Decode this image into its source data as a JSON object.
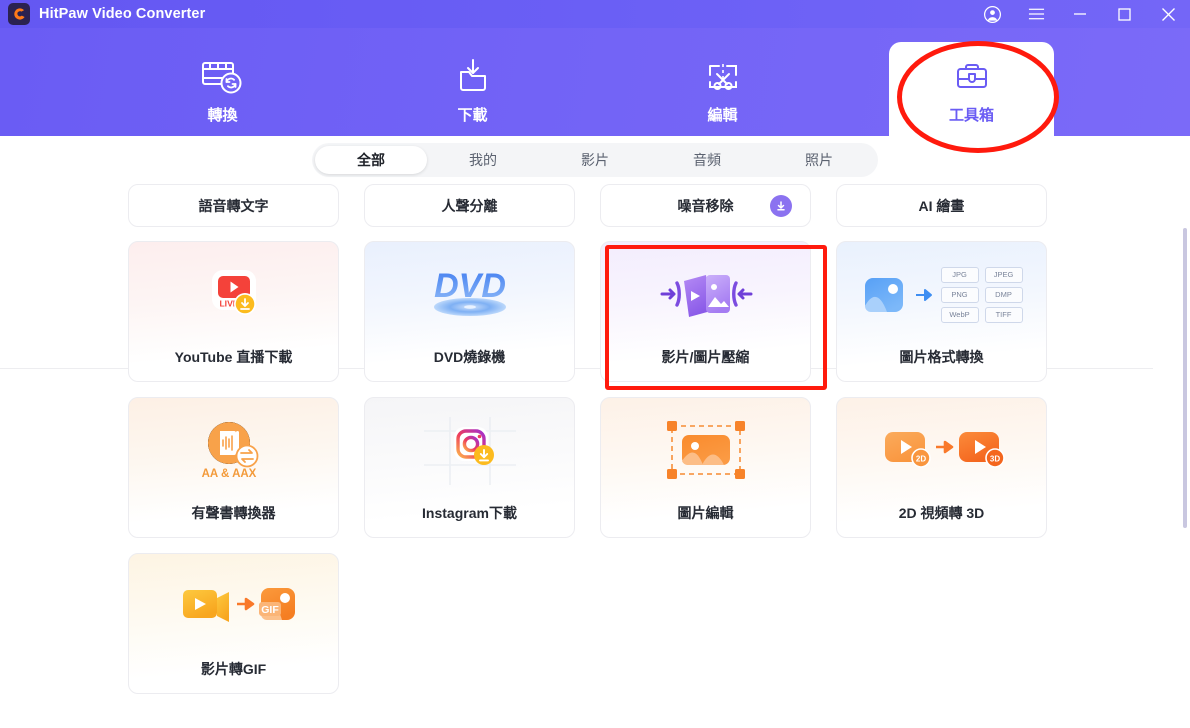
{
  "window": {
    "app_title": "HitPaw Video Converter",
    "logo_icon": "hitpaw-logo-icon",
    "controls": [
      {
        "name": "account-icon",
        "glyph": "account"
      },
      {
        "name": "menu-icon",
        "glyph": "menu"
      },
      {
        "name": "minimize-icon",
        "glyph": "minimize"
      },
      {
        "name": "maximize-icon",
        "glyph": "maximize"
      },
      {
        "name": "close-icon",
        "glyph": "close"
      }
    ],
    "header_color": "#6a5cf4"
  },
  "nav": {
    "tabs": [
      {
        "id": "convert",
        "label": "轉換",
        "icon": "film-convert-icon",
        "active": false
      },
      {
        "id": "download",
        "label": "下載",
        "icon": "folder-download-icon",
        "active": false
      },
      {
        "id": "edit",
        "label": "編輯",
        "icon": "screen-scissors-icon",
        "active": false
      },
      {
        "id": "toolbox",
        "label": "工具箱",
        "icon": "toolbox-icon",
        "active": true
      }
    ],
    "active_tab": "toolbox",
    "active_text_color": "#6a5cf4"
  },
  "filters": {
    "items": [
      {
        "label": "全部",
        "active": true
      },
      {
        "label": "我的",
        "active": false
      },
      {
        "label": "影片",
        "active": false
      },
      {
        "label": "音頻",
        "active": false
      },
      {
        "label": "照片",
        "active": false
      }
    ]
  },
  "annotations": [
    {
      "name": "highlight-ellipse-toolbox",
      "shape": "ellipse",
      "color": "#ff1a0d",
      "target": "工具箱"
    },
    {
      "name": "highlight-rect-compressor",
      "shape": "rectangle",
      "color": "#ff1a0d",
      "target": "影片/圖片壓縮"
    }
  ],
  "tools": {
    "row_partial": [
      {
        "title": "語音轉文字",
        "badge": null
      },
      {
        "title": "人聲分離",
        "badge": null
      },
      {
        "title": "噪音移除",
        "badge": "download-badge"
      },
      {
        "title": "AI 繪畫",
        "badge": null
      }
    ],
    "row2": [
      {
        "title": "YouTube 直播下載",
        "icon": "youtube-live-download-icon",
        "tint": "tint-pink",
        "highlighted": false
      },
      {
        "title": "DVD燒錄機",
        "icon": "dvd-burner-icon",
        "tint": "tint-blue",
        "highlighted": false
      },
      {
        "title": "影片/圖片壓縮",
        "icon": "media-compress-icon",
        "tint": "tint-purple",
        "highlighted": true
      },
      {
        "title": "圖片格式轉換",
        "icon": "image-format-convert-icon",
        "tint": "tint-blue2",
        "highlighted": false,
        "formats": [
          "JPG",
          "JPEG",
          "PNG",
          "DMP",
          "WebP",
          "TIFF"
        ]
      }
    ],
    "row3": [
      {
        "title": "有聲書轉換器",
        "icon": "audiobook-convert-icon",
        "tint": "tint-orange",
        "caption": "AA & AAX"
      },
      {
        "title": "Instagram下載",
        "icon": "instagram-download-icon",
        "tint": "tint-grey"
      },
      {
        "title": "圖片編輯",
        "icon": "image-edit-icon",
        "tint": "tint-orange2"
      },
      {
        "title": "2D 視頻轉 3D",
        "icon": "video-2d-to-3d-icon",
        "tint": "tint-orange2",
        "badge_from": "2D",
        "badge_to": "3D"
      }
    ],
    "row4": [
      {
        "title": "影片轉GIF",
        "icon": "video-to-gif-icon",
        "tint": "tint-yellow",
        "gif_label": "GIF"
      }
    ]
  },
  "scrollbar": {
    "name": "vertical-scrollbar",
    "color": "#c9c7e0"
  }
}
